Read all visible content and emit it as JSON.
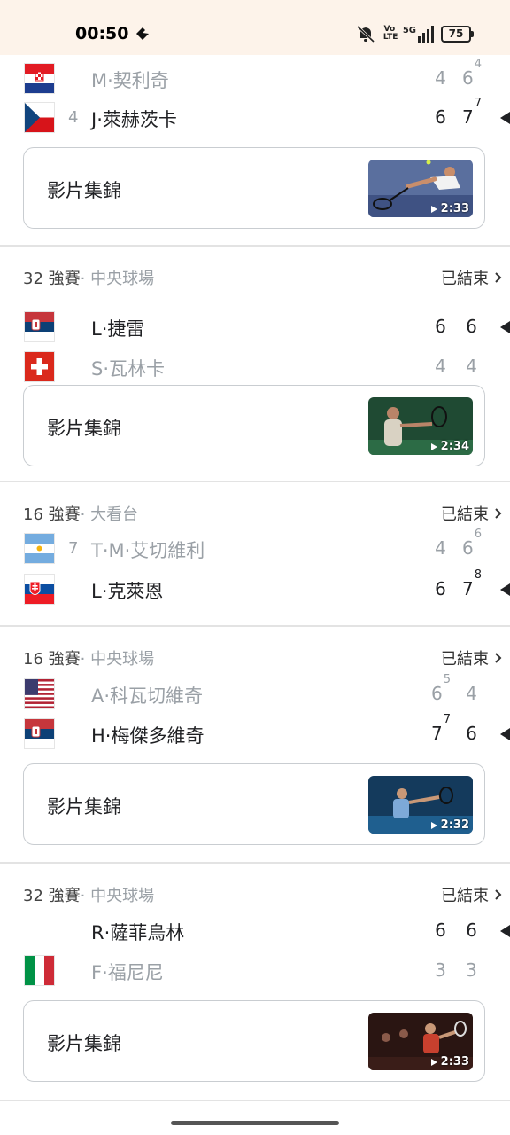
{
  "status_bar": {
    "time": "00:50",
    "volte": "Vo LTE",
    "network": "5G",
    "battery": "75"
  },
  "highlight_label": "影片集錦",
  "cards": [
    {
      "players": [
        {
          "name": "M·契利奇",
          "seed": "",
          "country": "croatia",
          "winner": false,
          "sets": [
            {
              "g": "4",
              "tb": ""
            },
            {
              "g": "6",
              "tb": "4"
            }
          ]
        },
        {
          "name": "J·萊赫茨卡",
          "seed": "4",
          "country": "czech",
          "winner": true,
          "sets": [
            {
              "g": "6",
              "tb": ""
            },
            {
              "g": "7",
              "tb": "7"
            }
          ]
        }
      ],
      "highlight": {
        "duration": "2:33"
      }
    },
    {
      "round": "32 強賽",
      "venue": "· 中央球場",
      "status": "已結束",
      "players": [
        {
          "name": "L·捷雷",
          "seed": "",
          "country": "serbia",
          "winner": true,
          "sets": [
            {
              "g": "6",
              "tb": ""
            },
            {
              "g": "6",
              "tb": ""
            }
          ]
        },
        {
          "name": "S·瓦林卡",
          "seed": "",
          "country": "switzerland",
          "winner": false,
          "sets": [
            {
              "g": "4",
              "tb": ""
            },
            {
              "g": "4",
              "tb": ""
            }
          ]
        }
      ],
      "highlight": {
        "duration": "2:34"
      }
    },
    {
      "round": "16 強賽",
      "venue": "· 大看台",
      "status": "已結束",
      "players": [
        {
          "name": "T·M·艾切維利",
          "seed": "7",
          "country": "argentina",
          "winner": false,
          "sets": [
            {
              "g": "4",
              "tb": ""
            },
            {
              "g": "6",
              "tb": "6"
            }
          ]
        },
        {
          "name": "L·克萊恩",
          "seed": "",
          "country": "slovakia",
          "winner": true,
          "sets": [
            {
              "g": "6",
              "tb": ""
            },
            {
              "g": "7",
              "tb": "8"
            }
          ]
        }
      ]
    },
    {
      "round": "16 強賽",
      "venue": "· 中央球場",
      "status": "已結束",
      "players": [
        {
          "name": "A·科瓦切維奇",
          "seed": "",
          "country": "usa",
          "winner": false,
          "sets": [
            {
              "g": "6",
              "tb": "5"
            },
            {
              "g": "4",
              "tb": ""
            }
          ]
        },
        {
          "name": "H·梅傑多維奇",
          "seed": "",
          "country": "serbia",
          "winner": true,
          "sets": [
            {
              "g": "7",
              "tb": "7"
            },
            {
              "g": "6",
              "tb": ""
            }
          ]
        }
      ],
      "highlight": {
        "duration": "2:32"
      }
    },
    {
      "round": "32 強賽",
      "venue": "· 中央球場",
      "status": "已結束",
      "players": [
        {
          "name": "R·薩菲烏林",
          "seed": "",
          "country": "",
          "winner": true,
          "sets": [
            {
              "g": "6",
              "tb": ""
            },
            {
              "g": "6",
              "tb": ""
            }
          ]
        },
        {
          "name": "F·福尼尼",
          "seed": "",
          "country": "italy",
          "winner": false,
          "sets": [
            {
              "g": "3",
              "tb": ""
            },
            {
              "g": "3",
              "tb": ""
            }
          ]
        }
      ],
      "highlight": {
        "duration": "2:33"
      }
    }
  ]
}
